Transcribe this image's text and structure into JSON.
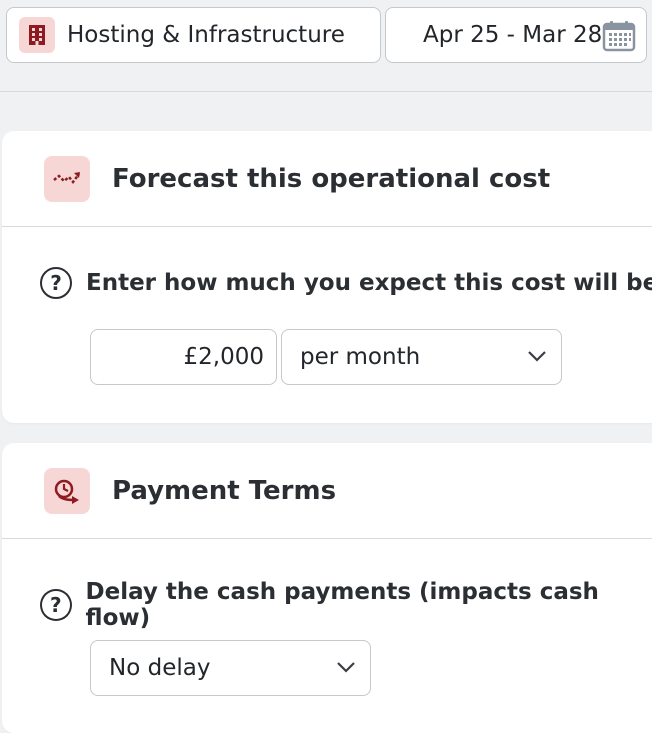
{
  "header": {
    "category": {
      "label": "Hosting & Infrastructure",
      "icon": "building-icon"
    },
    "date_range": {
      "label": "Apr 25 - Mar 28",
      "icon": "calendar-icon"
    }
  },
  "forecast": {
    "title": "Forecast this operational cost",
    "icon": "trend-arrow-icon",
    "question": "Enter how much you expect this cost will be",
    "amount": "£2,000",
    "period": "per month"
  },
  "payment_terms": {
    "title": "Payment Terms",
    "icon": "delay-arrow-icon",
    "question": "Delay the cash payments (impacts cash flow)",
    "delay": "No delay"
  },
  "colors": {
    "accent_bg": "#f6d7d6",
    "accent": "#8e1b22",
    "page_bg": "#f0f1f3"
  }
}
